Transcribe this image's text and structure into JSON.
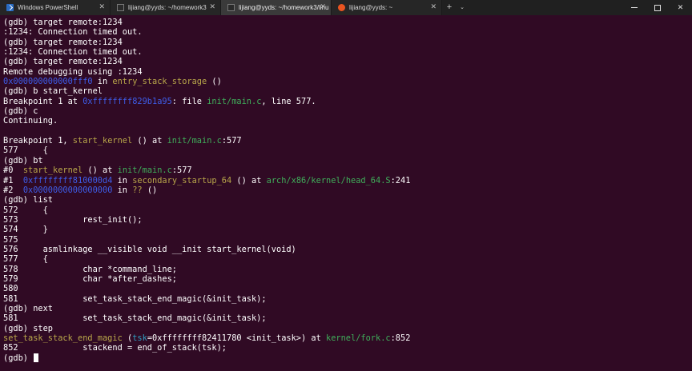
{
  "colors": {
    "background": "#300a24",
    "default": "#ffffff",
    "address": "#3e5de8",
    "function": "#b9a74a",
    "file": "#3fae5a",
    "parameter": "#2f9fc2"
  },
  "tabs": [
    {
      "title": "Windows PowerShell",
      "icon": "powershell-icon",
      "active": false
    },
    {
      "title": "lijiang@yyds: ~/homework3",
      "icon": "terminal-icon",
      "active": false
    },
    {
      "title": "lijiang@yyds: ~/homework3/linu",
      "icon": "terminal-icon",
      "active": true
    },
    {
      "title": "lijiang@yyds: ~",
      "icon": "ubuntu-icon",
      "active": false
    }
  ],
  "tab_close_glyph": "✕",
  "new_tab_glyph": "+",
  "dropdown_glyph": "⌄",
  "window_controls": {
    "close": "✕"
  },
  "terminal_lines": [
    [
      [
        "d",
        "(gdb) target remote:1234"
      ]
    ],
    [
      [
        "d",
        ":1234: Connection timed out."
      ]
    ],
    [
      [
        "d",
        "(gdb) target remote:1234"
      ]
    ],
    [
      [
        "d",
        ":1234: Connection timed out."
      ]
    ],
    [
      [
        "d",
        "(gdb) target remote:1234"
      ]
    ],
    [
      [
        "d",
        "Remote debugging using :1234"
      ]
    ],
    [
      [
        "b",
        "0x000000000000fff0"
      ],
      [
        "d",
        " in "
      ],
      [
        "y",
        "entry_stack_storage"
      ],
      [
        "d",
        " ()"
      ]
    ],
    [
      [
        "d",
        "(gdb) b start_kernel"
      ]
    ],
    [
      [
        "d",
        "Breakpoint 1 at "
      ],
      [
        "b",
        "0xffffffff829b1a95"
      ],
      [
        "d",
        ": file "
      ],
      [
        "g",
        "init/main.c"
      ],
      [
        "d",
        ", line 577."
      ]
    ],
    [
      [
        "d",
        "(gdb) c"
      ]
    ],
    [
      [
        "d",
        "Continuing."
      ]
    ],
    [
      [
        "d",
        ""
      ]
    ],
    [
      [
        "d",
        "Breakpoint 1, "
      ],
      [
        "y",
        "start_kernel"
      ],
      [
        "d",
        " () at "
      ],
      [
        "g",
        "init/main.c"
      ],
      [
        "d",
        ":577"
      ]
    ],
    [
      [
        "d",
        "577     {"
      ]
    ],
    [
      [
        "d",
        "(gdb) bt"
      ]
    ],
    [
      [
        "d",
        "#0  "
      ],
      [
        "y",
        "start_kernel"
      ],
      [
        "d",
        " () at "
      ],
      [
        "g",
        "init/main.c"
      ],
      [
        "d",
        ":577"
      ]
    ],
    [
      [
        "d",
        "#1  "
      ],
      [
        "b",
        "0xffffffff810000d4"
      ],
      [
        "d",
        " in "
      ],
      [
        "y",
        "secondary_startup_64"
      ],
      [
        "d",
        " () at "
      ],
      [
        "g",
        "arch/x86/kernel/head_64.S"
      ],
      [
        "d",
        ":241"
      ]
    ],
    [
      [
        "d",
        "#2  "
      ],
      [
        "b",
        "0x0000000000000000"
      ],
      [
        "d",
        " in "
      ],
      [
        "y",
        "??"
      ],
      [
        "d",
        " ()"
      ]
    ],
    [
      [
        "d",
        "(gdb) list"
      ]
    ],
    [
      [
        "d",
        "572     {"
      ]
    ],
    [
      [
        "d",
        "573             rest_init();"
      ]
    ],
    [
      [
        "d",
        "574     }"
      ]
    ],
    [
      [
        "d",
        "575"
      ]
    ],
    [
      [
        "d",
        "576     asmlinkage __visible void __init start_kernel(void)"
      ]
    ],
    [
      [
        "d",
        "577     {"
      ]
    ],
    [
      [
        "d",
        "578             char *command_line;"
      ]
    ],
    [
      [
        "d",
        "579             char *after_dashes;"
      ]
    ],
    [
      [
        "d",
        "580"
      ]
    ],
    [
      [
        "d",
        "581             set_task_stack_end_magic(&init_task);"
      ]
    ],
    [
      [
        "d",
        "(gdb) next"
      ]
    ],
    [
      [
        "d",
        "581             set_task_stack_end_magic(&init_task);"
      ]
    ],
    [
      [
        "d",
        "(gdb) step"
      ]
    ],
    [
      [
        "y",
        "set_task_stack_end_magic"
      ],
      [
        "d",
        " ("
      ],
      [
        "c",
        "tsk"
      ],
      [
        "d",
        "=0xffffffff82411780 <init_task>) at "
      ],
      [
        "g",
        "kernel/fork.c"
      ],
      [
        "d",
        ":852"
      ]
    ],
    [
      [
        "d",
        "852             stackend = end_of_stack(tsk);"
      ]
    ],
    [
      [
        "d",
        "(gdb) "
      ]
    ]
  ]
}
